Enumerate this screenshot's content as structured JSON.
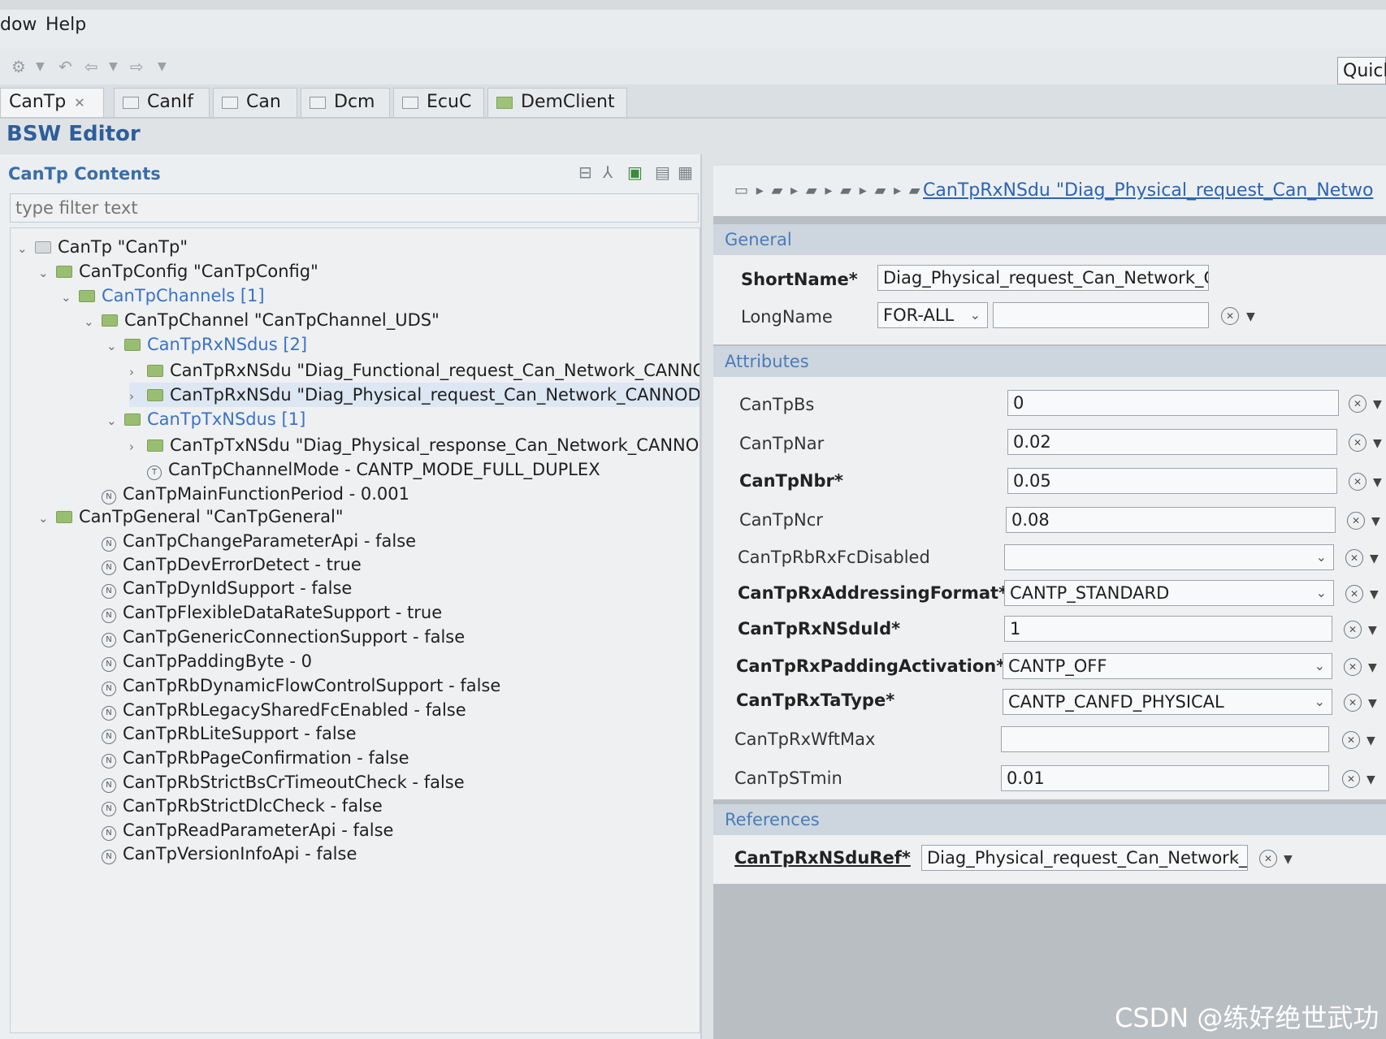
{
  "menubar": {
    "items": [
      "dow",
      "Help"
    ]
  },
  "toolbar": {
    "quick_label": "Quick"
  },
  "tabs": [
    {
      "label": "CanTp",
      "active": true
    },
    {
      "label": "CanIf"
    },
    {
      "label": "Can"
    },
    {
      "label": "Dcm"
    },
    {
      "label": "EcuC"
    },
    {
      "label": "DemClient"
    }
  ],
  "editor": {
    "title": "BSW Editor"
  },
  "left": {
    "title": "CanTp Contents",
    "filter_placeholder": "type filter text",
    "tree": [
      "CanTp \"CanTp\"",
      "CanTpConfig \"CanTpConfig\"",
      "CanTpChannels [1]",
      "CanTpChannel \"CanTpChannel_UDS\"",
      "CanTpRxNSdus [2]",
      "CanTpRxNSdu \"Diag_Functional_request_Can_Network_CANNOD",
      "CanTpRxNSdu \"Diag_Physical_request_Can_Network_CANNODE_(",
      "CanTpTxNSdus [1]",
      "CanTpTxNSdu \"Diag_Physical_response_Can_Network_CANNODE",
      "CanTpChannelMode - CANTP_MODE_FULL_DUPLEX",
      "CanTpMainFunctionPeriod - 0.001",
      "CanTpGeneral \"CanTpGeneral\"",
      "CanTpChangeParameterApi - false",
      "CanTpDevErrorDetect - true",
      "CanTpDynIdSupport - false",
      "CanTpFlexibleDataRateSupport - true",
      "CanTpGenericConnectionSupport - false",
      "CanTpPaddingByte - 0",
      "CanTpRbDynamicFlowControlSupport - false",
      "CanTpRbLegacySharedFcEnabled - false",
      "CanTpRbLiteSupport - false",
      "CanTpRbPageConfirmation - false",
      "CanTpRbStrictBsCrTimeoutCheck - false",
      "CanTpRbStrictDlcCheck - false",
      "CanTpReadParameterApi - false",
      "CanTpVersionInfoApi - false"
    ]
  },
  "right": {
    "breadcrumb": "CanTpRxNSdu \"Diag_Physical_request_Can_Netwo",
    "general": {
      "header": "General",
      "shortname_label": "ShortName*",
      "shortname_value": "Diag_Physical_request_Can_Network_CA",
      "longname_label": "LongName",
      "longname_lang": "FOR-ALL",
      "longname_value": ""
    },
    "attributes": {
      "header": "Attributes",
      "fields": [
        {
          "label": "CanTpBs",
          "value": "0"
        },
        {
          "label": "CanTpNar",
          "value": "0.02"
        },
        {
          "label": "CanTpNbr*",
          "value": "0.05"
        },
        {
          "label": "CanTpNcr",
          "value": "0.08"
        },
        {
          "label": "CanTpRbRxFcDisabled",
          "value": ""
        },
        {
          "label": "CanTpRxAddressingFormat*",
          "value": "CANTP_STANDARD"
        },
        {
          "label": "CanTpRxNSduId*",
          "value": "1"
        },
        {
          "label": "CanTpRxPaddingActivation*",
          "value": "CANTP_OFF"
        },
        {
          "label": "CanTpRxTaType*",
          "value": "CANTP_CANFD_PHYSICAL"
        },
        {
          "label": "CanTpRxWftMax",
          "value": ""
        },
        {
          "label": "CanTpSTmin",
          "value": "0.01"
        }
      ]
    },
    "references": {
      "header": "References",
      "ref_label": "CanTpRxNSduRef*",
      "ref_value": "Diag_Physical_request_Can_Network_"
    }
  },
  "watermark": "CSDN @练好绝世武功"
}
